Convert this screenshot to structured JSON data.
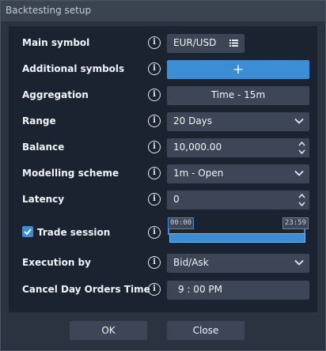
{
  "window": {
    "title": "Backtesting setup"
  },
  "rows": {
    "main_symbol": {
      "label": "Main symbol",
      "value": "EUR/USD"
    },
    "additional_symbols": {
      "label": "Additional symbols",
      "add_glyph": "+"
    },
    "aggregation": {
      "label": "Aggregation",
      "value": "Time - 15m"
    },
    "range": {
      "label": "Range",
      "value": "20 Days"
    },
    "balance": {
      "label": "Balance",
      "value": "10,000.00"
    },
    "modelling_scheme": {
      "label": "Modelling scheme",
      "value": "1m - Open"
    },
    "latency": {
      "label": "Latency",
      "value": "0"
    },
    "trade_session": {
      "label": "Trade session",
      "checked": true,
      "start": "00:00",
      "end": "23:59"
    },
    "execution_by": {
      "label": "Execution by",
      "value": "Bid/Ask"
    },
    "cancel_day_orders_time": {
      "label": "Cancel Day Orders Time",
      "value": "9 : 00 PM"
    }
  },
  "info_glyph": "i",
  "footer": {
    "ok_label": "OK",
    "close_label": "Close"
  },
  "colors": {
    "accent": "#3b8ed6",
    "panel": "#1c2330",
    "control": "#3c4656",
    "window": "#2b3340"
  }
}
